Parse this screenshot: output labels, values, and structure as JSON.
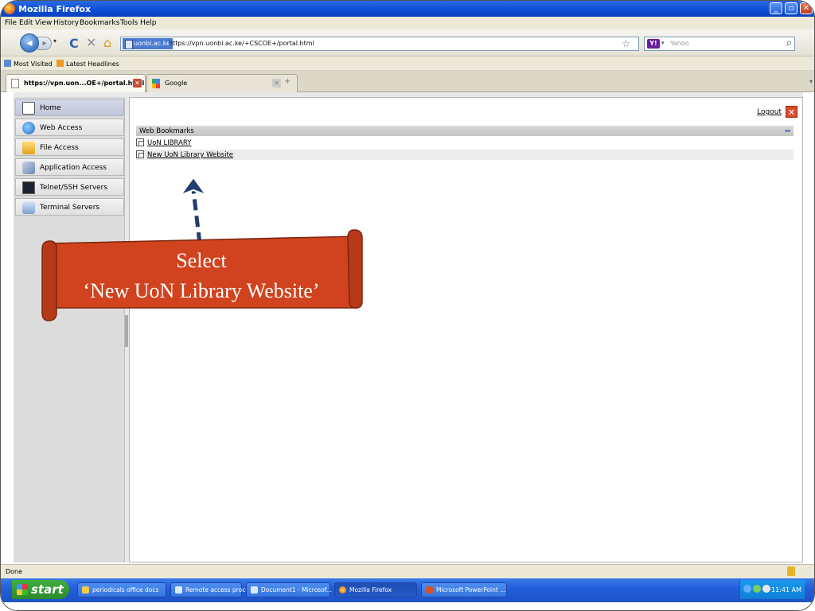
{
  "window": {
    "title": "Mozilla Firefox"
  },
  "menu": {
    "items": [
      "File",
      "Edit",
      "View",
      "History",
      "Bookmarks",
      "Tools",
      "Help"
    ]
  },
  "navbar": {
    "site_badge": "uonbi.ac.ke",
    "url": "https://vpn.uonbi.ac.ke/+CSCOE+/portal.html",
    "search_placeholder": "Yahoo"
  },
  "bookmarks_toolbar": {
    "items": [
      "Most Visited",
      "Latest Headlines"
    ]
  },
  "tabs": [
    {
      "label": "https://vpn.uon...OE+/portal.html",
      "active": true
    },
    {
      "label": "Google",
      "active": false
    }
  ],
  "sidebar": {
    "items": [
      {
        "label": "Home",
        "icon": "home-icon"
      },
      {
        "label": "Web Access",
        "icon": "globe-icon"
      },
      {
        "label": "File Access",
        "icon": "folder-icon"
      },
      {
        "label": "Application Access",
        "icon": "network-icon"
      },
      {
        "label": "Telnet/SSH Servers",
        "icon": "terminal-icon"
      },
      {
        "label": "Terminal Servers",
        "icon": "server-icon"
      }
    ]
  },
  "main": {
    "logout_label": "Logout",
    "panel_title": "Web Bookmarks",
    "bookmarks": [
      "UoN LIBRARY",
      "New UoN Library Website"
    ]
  },
  "callout": {
    "line1": "Select",
    "line2": "‘New UoN  Library Website’",
    "color": "#d0431e"
  },
  "status": {
    "text": "Done"
  },
  "taskbar": {
    "start_label": "start",
    "tasks": [
      "periodicals office docs",
      "Remote access proce...",
      "Document1 - Microsof...",
      "Mozilla Firefox",
      "Microsoft PowerPoint ..."
    ],
    "clock": "11:41 AM"
  }
}
